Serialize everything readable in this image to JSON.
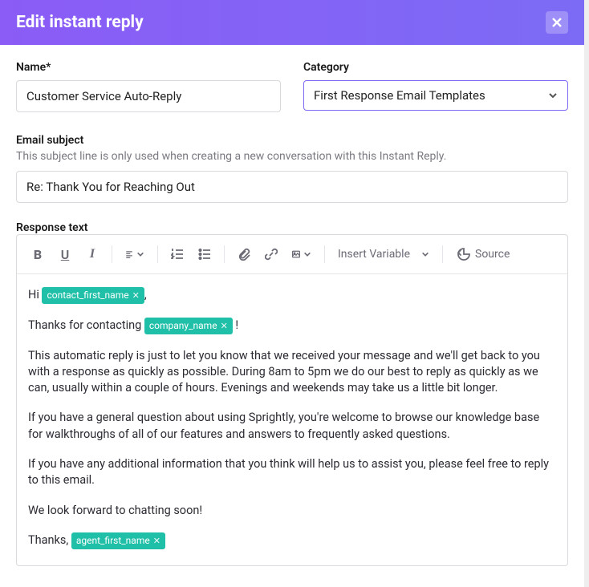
{
  "header": {
    "title": "Edit instant reply"
  },
  "fields": {
    "name_label": "Name",
    "name_value": "Customer Service Auto-Reply",
    "category_label": "Category",
    "category_value": "First Response Email Templates",
    "subject_label": "Email subject",
    "subject_help": "This subject line is only used when creating a new conversation with this Instant Reply.",
    "subject_value": "Re: Thank You for Reaching Out",
    "response_label": "Response text"
  },
  "toolbar": {
    "insert_variable_label": "Insert Variable",
    "source_label": "Source"
  },
  "body": {
    "greet_pre": "Hi ",
    "tag1": "contact_first_name",
    "greet_post": ",",
    "p2_pre": "Thanks for contacting ",
    "tag2": "company_name",
    "p2_post": " !",
    "p3": "This automatic reply is just to let you know that we received your message and we'll get back to you with a response as quickly as possible. During 8am to 5pm we do our best to reply as quickly as we can, usually within a couple of hours. Evenings and weekends may take us a little bit longer.",
    "p4": "If you have a general question about using Sprightly, you're welcome to browse our knowledge base for walkthroughs of all of our features and answers to frequently asked questions.",
    "p5": "If you have any additional information that you think will help us to assist you, please feel free to reply to this email.",
    "p6": "We look forward to chatting soon!",
    "p7_pre": "Thanks, ",
    "tag3": "agent_first_name"
  }
}
